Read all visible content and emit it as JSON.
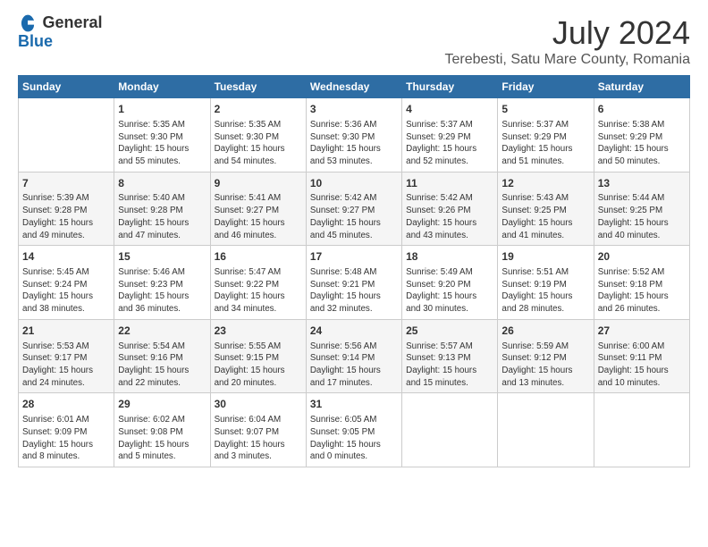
{
  "logo": {
    "general": "General",
    "blue": "Blue"
  },
  "title": "July 2024",
  "subtitle": "Terebesti, Satu Mare County, Romania",
  "headers": [
    "Sunday",
    "Monday",
    "Tuesday",
    "Wednesday",
    "Thursday",
    "Friday",
    "Saturday"
  ],
  "weeks": [
    [
      {
        "day": "",
        "content": ""
      },
      {
        "day": "1",
        "content": "Sunrise: 5:35 AM\nSunset: 9:30 PM\nDaylight: 15 hours\nand 55 minutes."
      },
      {
        "day": "2",
        "content": "Sunrise: 5:35 AM\nSunset: 9:30 PM\nDaylight: 15 hours\nand 54 minutes."
      },
      {
        "day": "3",
        "content": "Sunrise: 5:36 AM\nSunset: 9:30 PM\nDaylight: 15 hours\nand 53 minutes."
      },
      {
        "day": "4",
        "content": "Sunrise: 5:37 AM\nSunset: 9:29 PM\nDaylight: 15 hours\nand 52 minutes."
      },
      {
        "day": "5",
        "content": "Sunrise: 5:37 AM\nSunset: 9:29 PM\nDaylight: 15 hours\nand 51 minutes."
      },
      {
        "day": "6",
        "content": "Sunrise: 5:38 AM\nSunset: 9:29 PM\nDaylight: 15 hours\nand 50 minutes."
      }
    ],
    [
      {
        "day": "7",
        "content": "Sunrise: 5:39 AM\nSunset: 9:28 PM\nDaylight: 15 hours\nand 49 minutes."
      },
      {
        "day": "8",
        "content": "Sunrise: 5:40 AM\nSunset: 9:28 PM\nDaylight: 15 hours\nand 47 minutes."
      },
      {
        "day": "9",
        "content": "Sunrise: 5:41 AM\nSunset: 9:27 PM\nDaylight: 15 hours\nand 46 minutes."
      },
      {
        "day": "10",
        "content": "Sunrise: 5:42 AM\nSunset: 9:27 PM\nDaylight: 15 hours\nand 45 minutes."
      },
      {
        "day": "11",
        "content": "Sunrise: 5:42 AM\nSunset: 9:26 PM\nDaylight: 15 hours\nand 43 minutes."
      },
      {
        "day": "12",
        "content": "Sunrise: 5:43 AM\nSunset: 9:25 PM\nDaylight: 15 hours\nand 41 minutes."
      },
      {
        "day": "13",
        "content": "Sunrise: 5:44 AM\nSunset: 9:25 PM\nDaylight: 15 hours\nand 40 minutes."
      }
    ],
    [
      {
        "day": "14",
        "content": "Sunrise: 5:45 AM\nSunset: 9:24 PM\nDaylight: 15 hours\nand 38 minutes."
      },
      {
        "day": "15",
        "content": "Sunrise: 5:46 AM\nSunset: 9:23 PM\nDaylight: 15 hours\nand 36 minutes."
      },
      {
        "day": "16",
        "content": "Sunrise: 5:47 AM\nSunset: 9:22 PM\nDaylight: 15 hours\nand 34 minutes."
      },
      {
        "day": "17",
        "content": "Sunrise: 5:48 AM\nSunset: 9:21 PM\nDaylight: 15 hours\nand 32 minutes."
      },
      {
        "day": "18",
        "content": "Sunrise: 5:49 AM\nSunset: 9:20 PM\nDaylight: 15 hours\nand 30 minutes."
      },
      {
        "day": "19",
        "content": "Sunrise: 5:51 AM\nSunset: 9:19 PM\nDaylight: 15 hours\nand 28 minutes."
      },
      {
        "day": "20",
        "content": "Sunrise: 5:52 AM\nSunset: 9:18 PM\nDaylight: 15 hours\nand 26 minutes."
      }
    ],
    [
      {
        "day": "21",
        "content": "Sunrise: 5:53 AM\nSunset: 9:17 PM\nDaylight: 15 hours\nand 24 minutes."
      },
      {
        "day": "22",
        "content": "Sunrise: 5:54 AM\nSunset: 9:16 PM\nDaylight: 15 hours\nand 22 minutes."
      },
      {
        "day": "23",
        "content": "Sunrise: 5:55 AM\nSunset: 9:15 PM\nDaylight: 15 hours\nand 20 minutes."
      },
      {
        "day": "24",
        "content": "Sunrise: 5:56 AM\nSunset: 9:14 PM\nDaylight: 15 hours\nand 17 minutes."
      },
      {
        "day": "25",
        "content": "Sunrise: 5:57 AM\nSunset: 9:13 PM\nDaylight: 15 hours\nand 15 minutes."
      },
      {
        "day": "26",
        "content": "Sunrise: 5:59 AM\nSunset: 9:12 PM\nDaylight: 15 hours\nand 13 minutes."
      },
      {
        "day": "27",
        "content": "Sunrise: 6:00 AM\nSunset: 9:11 PM\nDaylight: 15 hours\nand 10 minutes."
      }
    ],
    [
      {
        "day": "28",
        "content": "Sunrise: 6:01 AM\nSunset: 9:09 PM\nDaylight: 15 hours\nand 8 minutes."
      },
      {
        "day": "29",
        "content": "Sunrise: 6:02 AM\nSunset: 9:08 PM\nDaylight: 15 hours\nand 5 minutes."
      },
      {
        "day": "30",
        "content": "Sunrise: 6:04 AM\nSunset: 9:07 PM\nDaylight: 15 hours\nand 3 minutes."
      },
      {
        "day": "31",
        "content": "Sunrise: 6:05 AM\nSunset: 9:05 PM\nDaylight: 15 hours\nand 0 minutes."
      },
      {
        "day": "",
        "content": ""
      },
      {
        "day": "",
        "content": ""
      },
      {
        "day": "",
        "content": ""
      }
    ]
  ]
}
